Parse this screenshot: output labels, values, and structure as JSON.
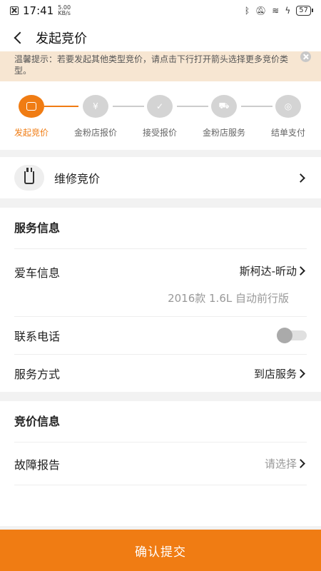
{
  "status_bar": {
    "time": "17:41",
    "net_speed": "5.00",
    "net_unit": "KB/s",
    "battery": "57"
  },
  "header": {
    "title": "发起竞价"
  },
  "notice": {
    "text": "温馨提示：若要发起其他类型竞价，请点击下行打开箭头选择更多竞价类型。"
  },
  "steps": [
    {
      "label": "发起竞价",
      "active": true
    },
    {
      "label": "金粉店报价",
      "active": false
    },
    {
      "label": "接受报价",
      "active": false
    },
    {
      "label": "金粉店服务",
      "active": false
    },
    {
      "label": "结单支付",
      "active": false
    }
  ],
  "repair": {
    "label": "维修竞价"
  },
  "service_info": {
    "title": "服务信息",
    "car_label": "爱车信息",
    "car_value": "斯柯达-昕动",
    "car_detail": "2016款 1.6L 自动前行版",
    "phone_label": "联系电话",
    "mode_label": "服务方式",
    "mode_value": "到店服务"
  },
  "bid_info": {
    "title": "竞价信息",
    "fault_label": "故障报告",
    "fault_placeholder": "请选择"
  },
  "submit_label": "确认提交",
  "colors": {
    "accent": "#f07c13",
    "notice_bg": "#f7e6d2"
  }
}
